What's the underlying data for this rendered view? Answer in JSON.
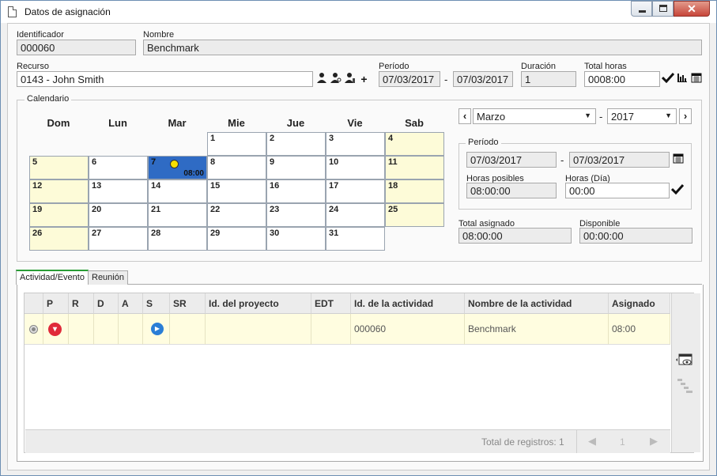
{
  "window": {
    "title": "Datos de asignación"
  },
  "fields": {
    "identificador_label": "Identificador",
    "identificador_value": "000060",
    "nombre_label": "Nombre",
    "nombre_value": "Benchmark",
    "recurso_label": "Recurso",
    "recurso_value": "0143 - John Smith",
    "periodo_label": "Período",
    "periodo_start": "07/03/2017",
    "periodo_sep": "-",
    "periodo_end": "07/03/2017",
    "duracion_label": "Duración",
    "duracion_value": "1",
    "total_horas_label": "Total horas",
    "total_horas_value": "0008:00"
  },
  "calendar": {
    "group_label": "Calendario",
    "weekdays": [
      "Dom",
      "Lun",
      "Mar",
      "Mie",
      "Jue",
      "Vie",
      "Sab"
    ],
    "weeks": [
      [
        "",
        "",
        "",
        "1",
        "2",
        "3",
        "4"
      ],
      [
        "5",
        "6",
        "7",
        "8",
        "9",
        "10",
        "11"
      ],
      [
        "12",
        "13",
        "14",
        "15",
        "16",
        "17",
        "18"
      ],
      [
        "19",
        "20",
        "21",
        "22",
        "23",
        "24",
        "25"
      ],
      [
        "26",
        "27",
        "28",
        "29",
        "30",
        "31",
        ""
      ]
    ],
    "selected_day": "7",
    "selected_time": "08:00",
    "month": "Marzo",
    "year": "2017",
    "month_year_sep": "-",
    "periodo": {
      "group_label": "Período",
      "start": "07/03/2017",
      "sep": "-",
      "end": "07/03/2017",
      "horas_posibles_label": "Horas posibles",
      "horas_posibles_value": "08:00:00",
      "horas_dia_label": "Horas (Día)",
      "horas_dia_value": "00:00"
    },
    "total_asignado_label": "Total asignado",
    "total_asignado_value": "08:00:00",
    "disponible_label": "Disponible",
    "disponible_value": "00:00:00"
  },
  "tabs": [
    {
      "label": "Actividad/Evento",
      "active": true
    },
    {
      "label": "Reunión",
      "active": false
    }
  ],
  "grid": {
    "columns": [
      "P",
      "R",
      "D",
      "A",
      "S",
      "SR",
      "Id. del proyecto",
      "EDT",
      "Id. de la actividad",
      "Nombre de la actividad",
      "Asignado"
    ],
    "rows": [
      {
        "id_proyecto": "",
        "edt": "",
        "id_actividad": "000060",
        "nombre_actividad": "Benchmark",
        "asignado": "08:00"
      }
    ],
    "total_label": "Total de registros: 1",
    "page": "1"
  },
  "colors": {
    "selected_day": "#2f6bc4",
    "weekend": "#fdfbd8",
    "row_highlight": "#fffde0",
    "tab_accent": "#2a9d35"
  }
}
